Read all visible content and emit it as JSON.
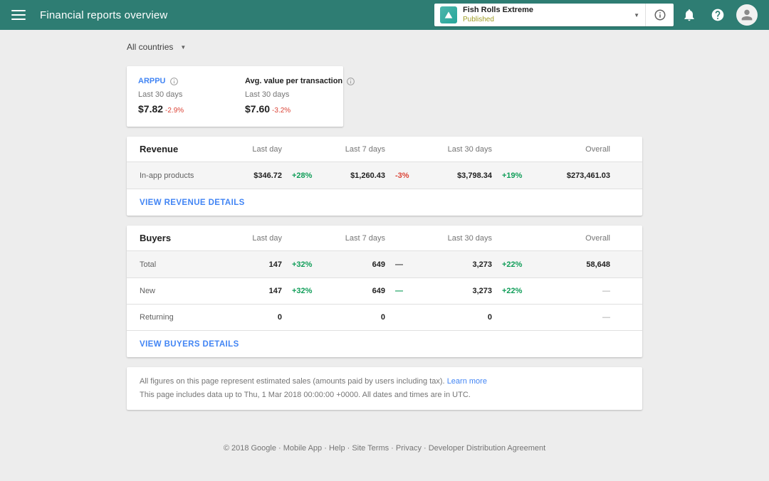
{
  "header": {
    "title": "Financial reports overview",
    "app_selector": {
      "name": "Fish Rolls Extreme",
      "status": "Published"
    }
  },
  "filters": {
    "country": "All countries"
  },
  "stats": {
    "arppu": {
      "label": "ARPPU",
      "period": "Last 30 days",
      "value": "$7.82",
      "change": "-2.9%",
      "trend": "neg"
    },
    "avg_transaction": {
      "label": "Avg. value per transaction",
      "period": "Last 30 days",
      "value": "$7.60",
      "change": "-3.2%",
      "trend": "neg"
    }
  },
  "revenue": {
    "title": "Revenue",
    "columns": {
      "last_day": "Last day",
      "last_7": "Last 7 days",
      "last_30": "Last 30 days",
      "overall": "Overall"
    },
    "rows": [
      {
        "label": "In-app products",
        "last_day": {
          "value": "$346.72",
          "change": "+28%",
          "trend": "pos"
        },
        "last_7": {
          "value": "$1,260.43",
          "change": "-3%",
          "trend": "neg"
        },
        "last_30": {
          "value": "$3,798.34",
          "change": "+19%",
          "trend": "pos"
        },
        "overall": {
          "value": "$273,461.03"
        }
      }
    ],
    "link": "VIEW REVENUE DETAILS"
  },
  "buyers": {
    "title": "Buyers",
    "columns": {
      "last_day": "Last day",
      "last_7": "Last 7 days",
      "last_30": "Last 30 days",
      "overall": "Overall"
    },
    "rows": [
      {
        "label": "Total",
        "last_day": {
          "value": "147",
          "change": "+32%",
          "trend": "pos"
        },
        "last_7": {
          "value": "649",
          "change": "—",
          "trend": "flat"
        },
        "last_30": {
          "value": "3,273",
          "change": "+22%",
          "trend": "pos"
        },
        "overall": {
          "value": "58,648"
        }
      },
      {
        "label": "New",
        "last_day": {
          "value": "147",
          "change": "+32%",
          "trend": "pos"
        },
        "last_7": {
          "value": "649",
          "change": "—",
          "trend": "pos"
        },
        "last_30": {
          "value": "3,273",
          "change": "+22%",
          "trend": "pos"
        },
        "overall": {
          "value": "—",
          "tone": "muted"
        }
      },
      {
        "label": "Returning",
        "last_day": {
          "value": "0",
          "change": "",
          "trend": "flat"
        },
        "last_7": {
          "value": "0",
          "change": "",
          "trend": "flat"
        },
        "last_30": {
          "value": "0",
          "change": "",
          "trend": "flat"
        },
        "overall": {
          "value": "—",
          "tone": "muted"
        }
      }
    ],
    "link": "VIEW BUYERS DETAILS"
  },
  "notes": {
    "line1": "All figures on this page represent estimated sales (amounts paid by users including tax).",
    "learn_more": "Learn more",
    "line2": "This page includes data up to Thu, 1 Mar 2018 00:00:00 +0000. All dates and times are in UTC."
  },
  "footer": {
    "text": "© 2018 Google · Mobile App · Help · Site Terms · Privacy · Developer Distribution Agreement"
  },
  "colors": {
    "header_teal": "#2e7d73",
    "positive": "#0f9d58",
    "negative": "#db4437",
    "link_blue": "#4285f4",
    "status_olive": "#9e9d24"
  }
}
